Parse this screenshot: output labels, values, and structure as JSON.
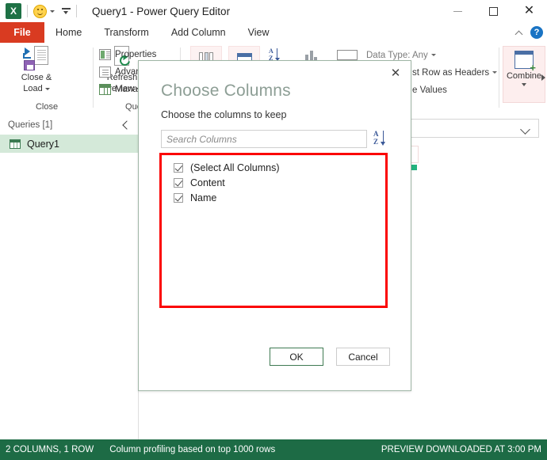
{
  "window": {
    "title": "Query1 - Power Query Editor",
    "app_icon": "excel-icon",
    "qat": {
      "smiley_icon": "smiley-face-icon",
      "customize_icon": "customize-quick-access-toolbar-icon"
    },
    "controls": {
      "minimize": "minimize-icon",
      "maximize": "maximize-icon",
      "close": "close-icon"
    }
  },
  "ribbon": {
    "tabs": [
      {
        "label": "File",
        "active": false,
        "is_file": true
      },
      {
        "label": "Home",
        "active": true,
        "is_file": false
      },
      {
        "label": "Transform",
        "active": false,
        "is_file": false
      },
      {
        "label": "Add Column",
        "active": false,
        "is_file": false
      },
      {
        "label": "View",
        "active": false,
        "is_file": false
      }
    ],
    "collapse_icon": "collapse-ribbon-chevron-icon",
    "help_label": "?",
    "groups": [
      {
        "label": "Close"
      },
      {
        "label": "Query"
      }
    ],
    "buttons": {
      "close_and_load_line1": "Close &",
      "close_and_load_line2": "Load",
      "refresh_line1": "Refresh",
      "refresh_line2": "Preview",
      "properties": "Properties",
      "advanced_editor": "Advanc",
      "manage": "Manage",
      "data_type": "Data Type: Any",
      "use_first_row_as_headers": "st Row as Headers",
      "replace_values": "e Values",
      "combine": "Combine"
    }
  },
  "queries_pane": {
    "header": "Queries [1]",
    "collapse_icon": "collapse-queries-pane-icon",
    "items": [
      {
        "label": "Query1",
        "icon": "table-icon",
        "selected": true
      }
    ]
  },
  "dialog": {
    "title": "Choose Columns",
    "subtitle": "Choose the columns to keep",
    "close_icon": "close-icon",
    "search": {
      "value": "",
      "placeholder": "Search Columns"
    },
    "sort_icon": "sort-a-to-z-icon",
    "columns": [
      {
        "label": "(Select All Columns)",
        "checked": true
      },
      {
        "label": "Content",
        "checked": true
      },
      {
        "label": "Name",
        "checked": true
      }
    ],
    "buttons": {
      "ok": "OK",
      "cancel": "Cancel"
    }
  },
  "annotation": {
    "highlight_color": "#fb0404"
  },
  "statusbar": {
    "left": "2 COLUMNS, 1 ROW",
    "middle": "Column profiling based on top 1000 rows",
    "right": "PREVIEW DOWNLOADED AT 3:00 PM",
    "background": "#1d6b45"
  }
}
